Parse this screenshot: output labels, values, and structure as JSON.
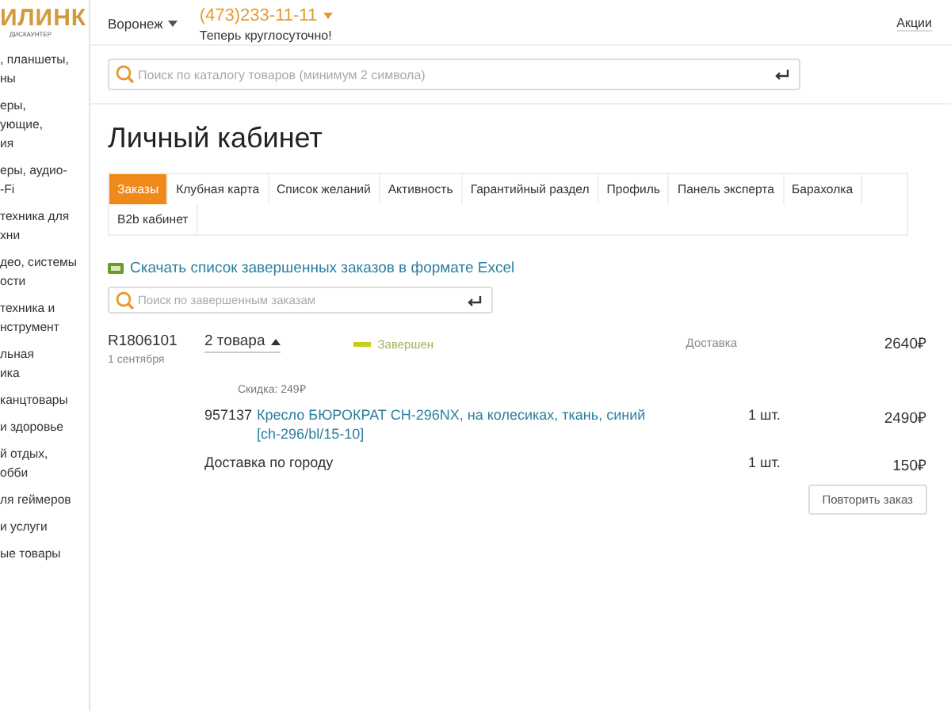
{
  "logo": {
    "text": "ИЛИНК",
    "subtitle": "ДИСКАУНТЕР"
  },
  "sidebar": {
    "items": [
      {
        "lines": [
          ", планшеты,",
          "ны"
        ]
      },
      {
        "lines": [
          "еры,",
          "ующие,",
          "ия"
        ]
      },
      {
        "lines": [
          "еры, аудио-",
          "-Fi"
        ]
      },
      {
        "lines": [
          "техника для",
          "хни"
        ]
      },
      {
        "lines": [
          "део, системы",
          "ости"
        ]
      },
      {
        "lines": [
          "техника и",
          "нструмент"
        ]
      },
      {
        "lines": [
          "льная",
          "ика"
        ]
      },
      {
        "lines": [
          "канцтовары"
        ]
      },
      {
        "lines": [
          "и здоровье"
        ]
      },
      {
        "lines": [
          "й отдых,",
          "обби"
        ]
      },
      {
        "lines": [
          "ля геймеров"
        ]
      },
      {
        "lines": [
          "и услуги"
        ]
      },
      {
        "lines": [
          "ые товары"
        ]
      }
    ]
  },
  "header": {
    "city": "Воронеж",
    "phone": "(473)233-11-11",
    "phone_note": "Теперь круглосуточно!",
    "links": [
      "Акции"
    ]
  },
  "search": {
    "placeholder": "Поиск по каталогу товаров (минимум 2 символа)"
  },
  "page_title": "Личный кабинет",
  "tabs": [
    {
      "label": "Заказы",
      "selected": true
    },
    {
      "label": "Клубная карта",
      "selected": false
    },
    {
      "label": "Список желаний",
      "selected": false
    },
    {
      "label": "Активность",
      "selected": false
    },
    {
      "label": "Гарантийный раздел",
      "selected": false
    },
    {
      "label": "Профиль",
      "selected": false
    },
    {
      "label": "Панель эксперта",
      "selected": false
    },
    {
      "label": "Барахолка",
      "selected": false
    },
    {
      "label": "B2b кабинет",
      "selected": false
    }
  ],
  "excel_link": "Скачать список завершенных заказов в формате Excel",
  "order_search": {
    "placeholder": "Поиск по завершенным заказам"
  },
  "order": {
    "number": "R1806101",
    "date": "1 сентября",
    "items_toggle": "2 товара",
    "expanded": true,
    "status": "Завершен",
    "delivery_label": "Доставка",
    "total": "2640₽",
    "discount": "Скидка: 249₽",
    "lines": [
      {
        "kind": "product",
        "code": "957137",
        "name": "Кресло БЮРОКРАТ CH-296NX, на колесиках, ткань, синий [ch-296/bl/15-10]",
        "qty": "1 шт.",
        "price": "2490₽"
      },
      {
        "kind": "service",
        "name": "Доставка по городу",
        "qty": "1 шт.",
        "price": "150₽"
      }
    ],
    "repeat_button": "Повторить заказ"
  }
}
